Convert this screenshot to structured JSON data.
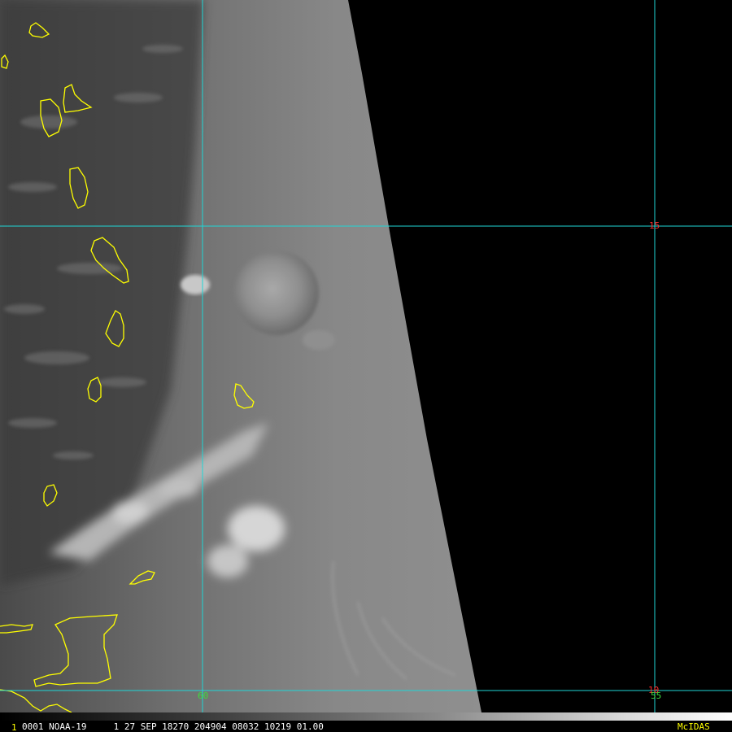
{
  "image": {
    "type": "satellite-image",
    "sensor": "NOAA-19",
    "colors": {
      "coastline": "#ffff00",
      "graticule": "#1fd6d6",
      "latitude_label": "#ff2a2a",
      "longitude_label": "#3ddc3d",
      "no_data": "#000000"
    }
  },
  "graticule": {
    "latitude_labels": [
      "15",
      "10"
    ],
    "longitude_labels": [
      "60",
      "55"
    ]
  },
  "status_bar": {
    "cursor_marker": "1",
    "text": "0001 NOAA-19     1 27 SEP 18270 204904 08032 10219 01.00",
    "brand": "McIDAS"
  }
}
